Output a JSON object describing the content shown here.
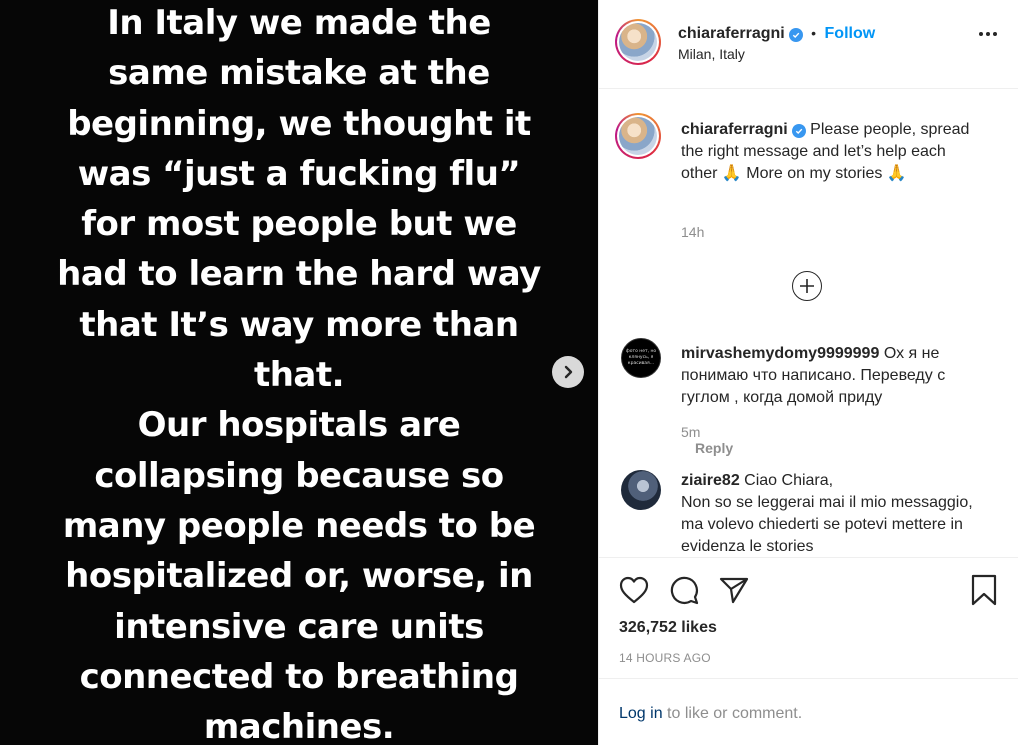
{
  "post_image": {
    "lines": [
      "In Italy we made the",
      "same mistake at the",
      "beginning, we thought it",
      "was “just a fucking flu”",
      "for most people but we",
      "had to learn the hard way",
      "that It’s way more than",
      "that.",
      "Our hospitals are",
      "collapsing because so",
      "many people needs to be",
      "hospitalized or, worse, in",
      "intensive care units",
      "connected to breathing",
      "machines."
    ]
  },
  "header": {
    "username": "chiaraferragni",
    "separator": "•",
    "follow_label": "Follow",
    "location": "Milan, Italy"
  },
  "caption": {
    "username": "chiaraferragni",
    "text_part1": "Please people, spread the right message and let’s help each other",
    "text_part2": "More on my stories",
    "emoji": "🙏",
    "time": "14h"
  },
  "comments": [
    {
      "username": "mirvashemydomy9999999",
      "text": "Ох я не понимаю что написано. Переведу с гуглом , когда домой приду",
      "time": "5m",
      "reply_label": "Reply",
      "avatar_text": "фото нет, но клянусь, я красивая..."
    },
    {
      "username": "ziaire82",
      "text": "Ciao Chiara,",
      "text2": "Non so se leggerai mai il mio messaggio, ma volevo chiederti se potevi mettere in evidenza le stories"
    }
  ],
  "actions": {
    "likes": "326,752 likes",
    "posted_ago": "14 HOURS AGO",
    "login_link": "Log in",
    "login_suffix": " to like or comment."
  },
  "colors": {
    "accent": "#0095f6",
    "verified": "#3897f0",
    "muted": "#8e8e8e",
    "link_dark": "#00376b"
  }
}
